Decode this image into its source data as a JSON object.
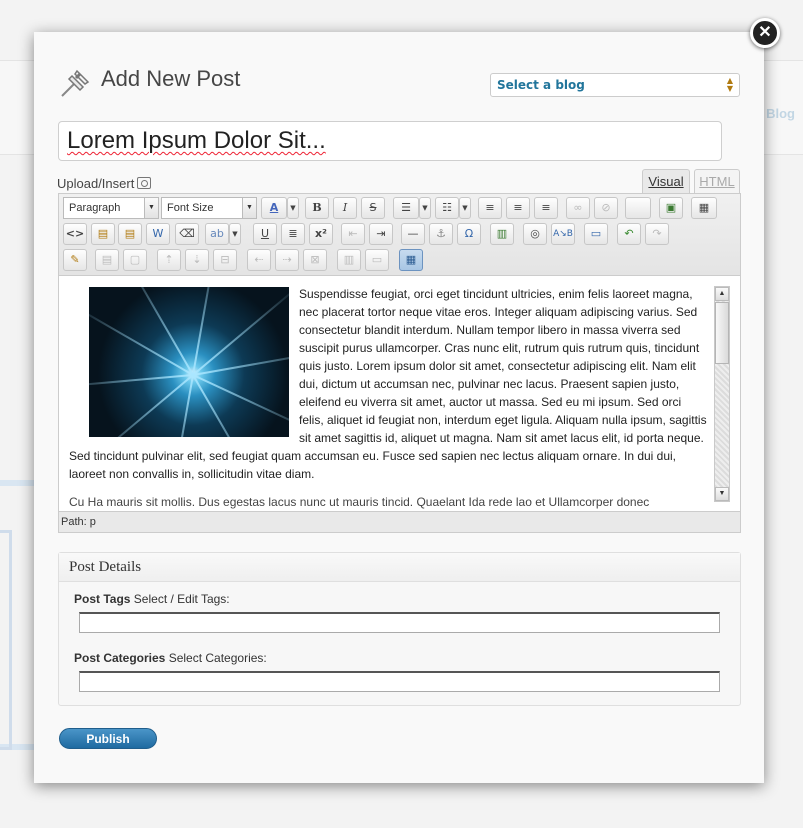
{
  "background": {
    "blog_label": "Blog"
  },
  "modal": {
    "title": "Add New Post",
    "close_icon": "close-icon",
    "blog_select": {
      "value": "Select a blog"
    },
    "post_title": "Lorem Ipsum Dolor Sit...",
    "upload_label": "Upload/Insert",
    "tabs": {
      "visual": "Visual",
      "html": "HTML"
    }
  },
  "toolbar": {
    "paragraph_select": "Paragraph",
    "font_size_select": "Font Size",
    "bold": "B",
    "italic": "I",
    "strike": "S",
    "underline": "U",
    "superscript": "x²",
    "html_code": "<>",
    "omega": "Ω"
  },
  "editor": {
    "paragraph1": "Suspendisse feugiat, orci eget tincidunt ultricies, enim felis laoreet magna, nec placerat tortor neque vitae eros. Integer aliquam adipiscing varius. Sed consectetur blandit interdum. Nullam tempor libero in massa viverra sed suscipit purus ullamcorper. Cras nunc elit, rutrum quis rutrum quis, tincidunt quis justo. Lorem ipsum dolor sit amet, consectetur adipiscing elit. Nam elit dui, dictum ut accumsan nec, pulvinar nec lacus. Praesent sapien justo, eleifend eu viverra sit amet, auctor ut massa. Sed eu mi ipsum. Sed orci felis, aliquet id feugiat non, interdum eget ligula. Aliquam nulla ipsum, sagittis sit amet sagittis id, aliquet ut magna. Nam sit amet lacus elit, id porta neque. Sed tincidunt pulvinar elit, sed feugiat quam accumsan eu. Fusce sed sapien nec lectus aliquam ornare. In dui dui, laoreet non convallis in, sollicitudin vitae diam.",
    "paragraph2": "Cu Ha mauris sit mollis. Dus egestas lacus nunc ut mauris tincid. Quaelant Ida rede lao et Ullamcorper donec",
    "path": "Path: p"
  },
  "details": {
    "heading": "Post Details",
    "tags_label_bold": "Post Tags",
    "tags_label_rest": " Select / Edit Tags:",
    "categories_label_bold": "Post Categories",
    "categories_label_rest": " Select Categories:"
  },
  "publish_label": "Publish",
  "colors": {
    "accent": "#21759b",
    "publish": "#2a78ad",
    "select_arrows": "#b07a10"
  }
}
